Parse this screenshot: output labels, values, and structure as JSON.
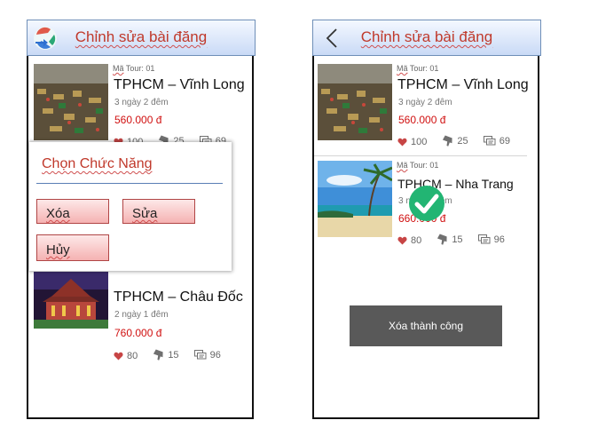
{
  "screen_a": {
    "header": {
      "title": "Chỉnh sửa bài đăng",
      "logo_icon": "app-logo-icon"
    },
    "cards": [
      {
        "code_prefix": "Mã",
        "code_rest": " Tour: 01",
        "name": "TPHCM – Vĩnh Long",
        "duration": "3 ngày 2 đêm",
        "price": "560.000 đ",
        "likes": "100",
        "dislikes": "25",
        "comments": "69"
      },
      {
        "name": "TPHCM – Châu Đốc",
        "duration": "2 ngày 1 đêm",
        "price": "760.000 đ",
        "likes": "80",
        "dislikes": "15",
        "comments": "96"
      }
    ],
    "dialog": {
      "title": "Chọn Chức Năng",
      "delete_label": "Xóa",
      "edit_label": "Sửa",
      "cancel_label": "Hủy"
    }
  },
  "screen_b": {
    "header": {
      "title": "Chỉnh sửa bài đăng",
      "back_icon": "chevron-left-icon"
    },
    "cards": [
      {
        "code_prefix": "Mã",
        "code_rest": " Tour: 01",
        "name": "TPHCM – Vĩnh Long",
        "duration": "3 ngày 2 đêm",
        "price": "560.000 đ",
        "likes": "100",
        "dislikes": "25",
        "comments": "69"
      },
      {
        "code_prefix": "Mã",
        "code_rest": " Tour: 01",
        "name": "TPHCM – Nha Trang",
        "duration": "3 ngày 2 đêm",
        "price": "660.000 đ",
        "likes": "80",
        "dislikes": "15",
        "comments": "96"
      }
    ],
    "toast": "Xóa thành công",
    "success_icon": "check-circle-icon"
  },
  "colors": {
    "accent_red": "#d01010",
    "header_title": "#c0392b",
    "success_green": "#22b573",
    "toast_bg": "#595959"
  }
}
